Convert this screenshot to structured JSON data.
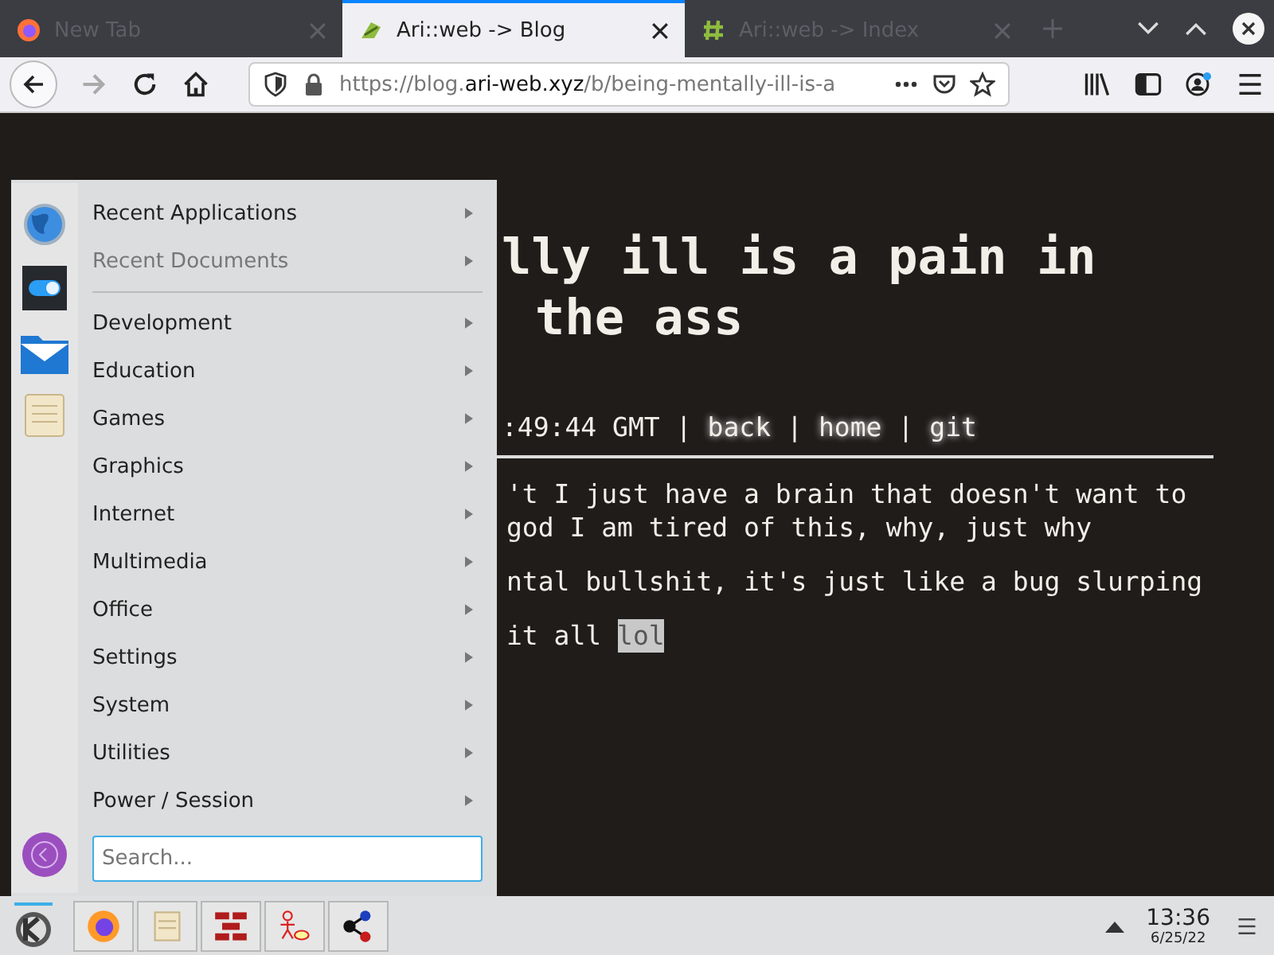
{
  "tabs": [
    {
      "title": "New Tab",
      "selected": false
    },
    {
      "title": "Ari::web -> Blog",
      "selected": true
    },
    {
      "title": "Ari::web -> Index",
      "selected": false
    }
  ],
  "nav": {
    "forward_disabled": true,
    "url_scheme": "https://blog.",
    "url_domain": "ari-web.xyz",
    "url_path": "/b/being-mentally-ill-is-a"
  },
  "page": {
    "title_lines": [
      "lly ill is a pain in",
      "the ass"
    ],
    "timestamp": ":49:44 GMT",
    "links": [
      {
        "separator": "|",
        "label": "back"
      },
      {
        "separator": "|",
        "label": "home"
      },
      {
        "separator": "|",
        "label": "git"
      }
    ],
    "paragraphs": [
      {
        "lines": [
          "'t I just have a brain that doesn't want to",
          "god I am tired of this, why, just why"
        ]
      },
      {
        "lines": [
          "ntal bullshit, it's just like a bug slurping"
        ]
      },
      {
        "lines": [
          "it all "
        ],
        "selected_text": "lol"
      }
    ]
  },
  "menu": {
    "items": [
      {
        "label": "Recent Applications",
        "disabled": false
      },
      {
        "label": "Recent Documents",
        "disabled": true
      },
      {
        "label": "Development",
        "disabled": false
      },
      {
        "label": "Education",
        "disabled": false
      },
      {
        "label": "Games",
        "disabled": false
      },
      {
        "label": "Graphics",
        "disabled": false
      },
      {
        "label": "Internet",
        "disabled": false
      },
      {
        "label": "Multimedia",
        "disabled": false
      },
      {
        "label": "Office",
        "disabled": false
      },
      {
        "label": "Settings",
        "disabled": false
      },
      {
        "label": "System",
        "disabled": false
      },
      {
        "label": "Utilities",
        "disabled": false
      },
      {
        "label": "Power / Session",
        "disabled": false
      }
    ],
    "search": {
      "placeholder": "Search..."
    }
  },
  "taskbar": {
    "time": "13:36",
    "date": "6/25/22"
  }
}
